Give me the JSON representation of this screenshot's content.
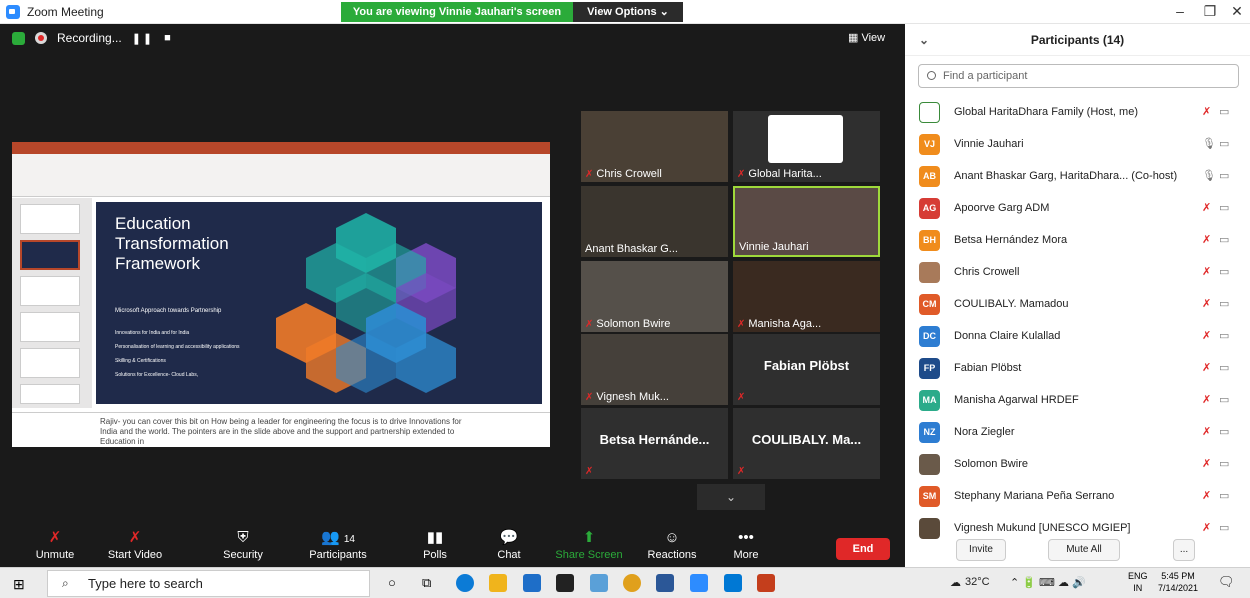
{
  "window": {
    "title": "Zoom Meeting"
  },
  "banner": {
    "viewing": "You are viewing Vinnie Jauhari's screen",
    "view_options": "View Options ⌄"
  },
  "topbar": {
    "recording": "Recording...",
    "view": "View"
  },
  "slide": {
    "title": "Education\nTransformation\nFramework",
    "subtitle": "Microsoft Approach towards Partnership",
    "bullets": [
      "Innovations for India and for India",
      "Personalisation of learning and accessibility applications",
      "Skilling & Certifications",
      "Solutions for Excellence- Cloud Labs,"
    ],
    "notes": "Rajiv-  you can cover this bit on How being a leader for engineering the focus is to drive Innovations for India and the world. The pointers are in the slide above and the support and partnership extended to Education in"
  },
  "tiles": [
    {
      "name": "Chris Crowell",
      "type": "video"
    },
    {
      "name": "Global Harita...",
      "type": "video"
    },
    {
      "name": "Anant Bhaskar G...",
      "type": "video"
    },
    {
      "name": "Vinnie Jauhari",
      "type": "video",
      "active": true
    },
    {
      "name": "Solomon Bwire",
      "type": "video"
    },
    {
      "name": "Manisha Aga...",
      "type": "video"
    },
    {
      "name": "Vignesh Muk...",
      "type": "video"
    },
    {
      "name": "Fabian Plöbst",
      "type": "name"
    },
    {
      "name": "Betsa Hernánde...",
      "type": "name"
    },
    {
      "name": "COULIBALY. Ma...",
      "type": "name"
    }
  ],
  "toolbar": {
    "unmute": "Unmute",
    "start_video": "Start Video",
    "security": "Security",
    "participants": "Participants",
    "participants_count": "14",
    "polls": "Polls",
    "chat": "Chat",
    "share_screen": "Share Screen",
    "reactions": "Reactions",
    "more": "More",
    "end": "End"
  },
  "panel": {
    "title": "Participants (14)",
    "search_placeholder": "Find a participant",
    "participants": [
      {
        "name": "Global HaritaDhara Family (Host, me)",
        "initials": "",
        "color": "#ffffff"
      },
      {
        "name": "Vinnie Jauhari",
        "initials": "VJ",
        "color": "#f08c1c"
      },
      {
        "name": "Anant Bhaskar Garg, HaritaDhara... (Co-host)",
        "initials": "AB",
        "color": "#f08c1c"
      },
      {
        "name": "Apoorve Garg ADM",
        "initials": "AG",
        "color": "#d63c35"
      },
      {
        "name": "Betsa Hernández Mora",
        "initials": "BH",
        "color": "#f08c1c"
      },
      {
        "name": "Chris Crowell",
        "initials": "",
        "color": "#a87a5a"
      },
      {
        "name": "COULIBALY. Mamadou",
        "initials": "CM",
        "color": "#e05a28"
      },
      {
        "name": "Donna Claire Kulallad",
        "initials": "DC",
        "color": "#2d7dd2"
      },
      {
        "name": "Fabian Plöbst",
        "initials": "FP",
        "color": "#1e4b8a"
      },
      {
        "name": "Manisha Agarwal HRDEF",
        "initials": "MA",
        "color": "#2bab8a"
      },
      {
        "name": "Nora Ziegler",
        "initials": "NZ",
        "color": "#2d7dd2"
      },
      {
        "name": "Solomon Bwire",
        "initials": "",
        "color": "#6a5a4a"
      },
      {
        "name": "Stephany Mariana Peña Serrano",
        "initials": "SM",
        "color": "#e05a28"
      },
      {
        "name": "Vignesh Mukund [UNESCO MGIEP]",
        "initials": "",
        "color": "#5a4a3a"
      }
    ],
    "invite": "Invite",
    "mute_all": "Mute All",
    "more": "..."
  },
  "taskbar": {
    "search": "Type here to search",
    "temp": "32°C",
    "lang1": "ENG",
    "lang2": "IN",
    "time": "5:45 PM",
    "date": "7/14/2021"
  }
}
